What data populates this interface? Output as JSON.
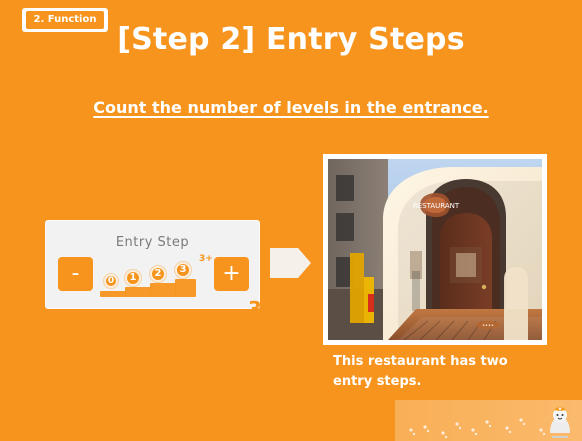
{
  "section_tag": "2. Function",
  "title": "[Step 2] Entry Steps",
  "subtitle": "Count the number of levels in the entrance.",
  "widget": {
    "label": "Entry Step",
    "minus": "-",
    "plus": "+",
    "step_options": [
      "0",
      "1",
      "2",
      "3",
      "3+"
    ],
    "current_value": "3"
  },
  "caption_lines": [
    "This restaurant has two",
    "entry steps."
  ],
  "photo_sign_text": "RESTAURANT",
  "colors": {
    "background": "#F7941D",
    "white": "#FFFFFF",
    "widget_bg": "#F2F2F2"
  },
  "icons": {
    "arrow": "right-arrow-icon",
    "minus": "minus-icon",
    "plus": "plus-icon"
  }
}
